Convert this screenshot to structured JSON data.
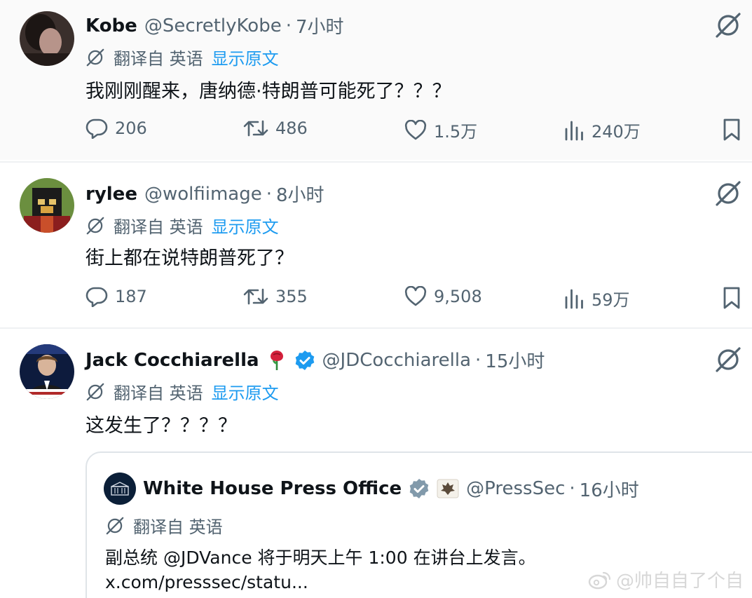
{
  "tweets": [
    {
      "name": "Kobe",
      "handle": "@SecretlyKobe",
      "separator": "·",
      "time": "7小时",
      "translate_label": "翻译自 英语",
      "show_original": "显示原文",
      "text": "我刚刚醒来，唐纳德·特朗普可能死了？？？",
      "replies": "206",
      "reposts": "486",
      "likes": "1.5万",
      "views": "240万"
    },
    {
      "name": "rylee",
      "handle": "@wolfiimage",
      "separator": "·",
      "time": "8小时",
      "translate_label": "翻译自 英语",
      "show_original": "显示原文",
      "text": "街上都在说特朗普死了？",
      "replies": "187",
      "reposts": "355",
      "likes": "9,508",
      "views": "59万"
    },
    {
      "name": "Jack Cocchiarella",
      "handle": "@JDCocchiarella",
      "separator": "·",
      "time": "15小时",
      "translate_label": "翻译自 英语",
      "show_original": "显示原文",
      "text": "这发生了？？？？",
      "quoted": {
        "name": "White House Press Office",
        "handle": "@PressSec",
        "separator": "·",
        "time": "16小时",
        "translate_label": "翻译自 英语",
        "text": "副总统 @JDVance 将于明天上午 1:00 在讲台上发言。",
        "link": "x.com/presssec/statu..."
      }
    }
  ],
  "watermark": "@帅自自了个自",
  "colors": {
    "accent": "#1d9bf0",
    "verified": "#1d9bf0",
    "verified_gov": "#829aab",
    "secondary_text": "#536471"
  }
}
